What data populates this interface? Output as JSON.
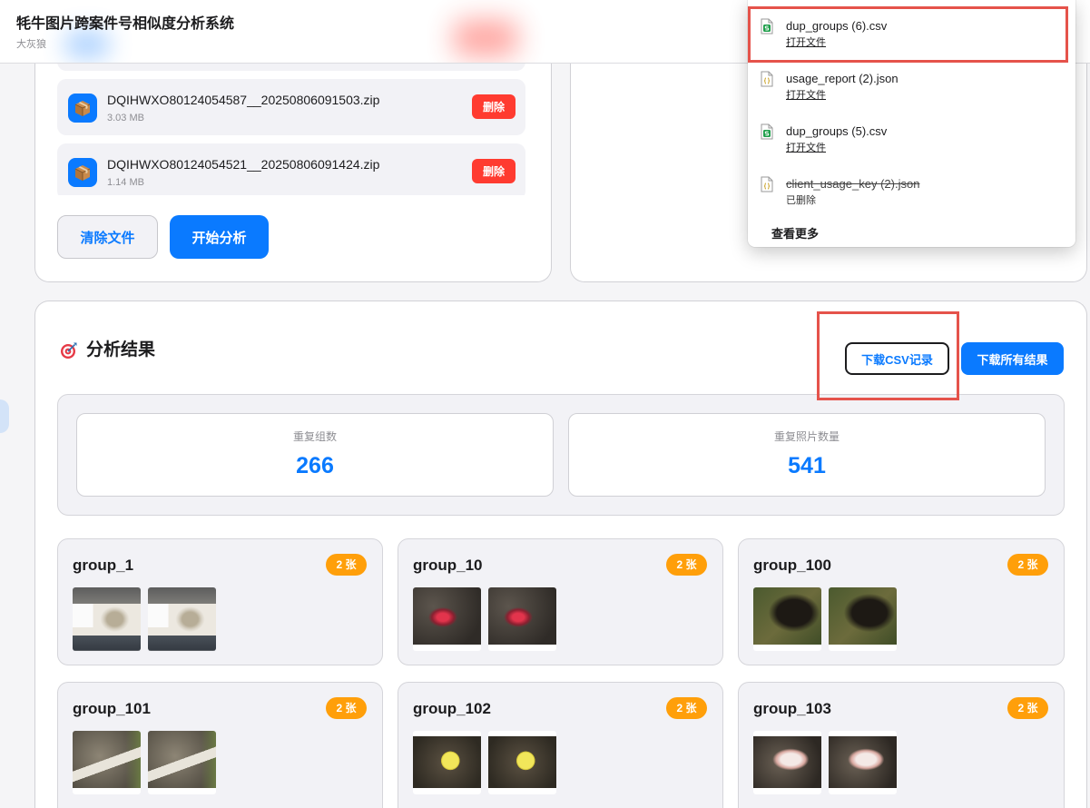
{
  "app": {
    "title": "牦牛图片跨案件号相似度分析系统",
    "subtitle": "大灰狼"
  },
  "upload": {
    "files": [
      {
        "name": "DQIHWXO80124054587__20250806091503.zip",
        "size": "3.03 MB",
        "icon": "package-icon",
        "delete_label": "删除"
      },
      {
        "name": "DQIHWXO80124054521__20250806091424.zip",
        "size": "1.14 MB",
        "icon": "package-icon",
        "delete_label": "删除"
      }
    ],
    "clear_label": "清除文件",
    "start_label": "开始分析"
  },
  "downloads": {
    "items": [
      {
        "name": "dup_groups (6).csv",
        "status": "打开文件",
        "icon": "csv-file-icon",
        "deleted": false,
        "highlighted": true
      },
      {
        "name": "usage_report (2).json",
        "status": "打开文件",
        "icon": "json-file-icon",
        "deleted": false
      },
      {
        "name": "dup_groups (5).csv",
        "status": "打开文件",
        "icon": "csv-file-icon",
        "deleted": false
      },
      {
        "name": "client_usage_key (2).json",
        "status": "已删除",
        "icon": "json-file-icon",
        "deleted": true
      }
    ],
    "more_label": "查看更多"
  },
  "results": {
    "title": "分析结果",
    "title_icon": "target-icon",
    "download_csv_label": "下载CSV记录",
    "download_csv_highlighted": true,
    "download_all_label": "下载所有结果",
    "stats": [
      {
        "label": "重复组数",
        "value": "266"
      },
      {
        "label": "重复照片数量",
        "value": "541"
      }
    ],
    "groups": [
      {
        "name": "group_1",
        "count": "2 张"
      },
      {
        "name": "group_10",
        "count": "2 张"
      },
      {
        "name": "group_100",
        "count": "2 张"
      },
      {
        "name": "group_101",
        "count": "2 张"
      },
      {
        "name": "group_102",
        "count": "2 张"
      },
      {
        "name": "group_103",
        "count": "2 张"
      }
    ]
  },
  "colors": {
    "accent": "#0a7aff",
    "danger": "#ff3b30",
    "badge": "#ff9f0a",
    "highlight": "#e5534b",
    "background": "#f5f5f7"
  }
}
